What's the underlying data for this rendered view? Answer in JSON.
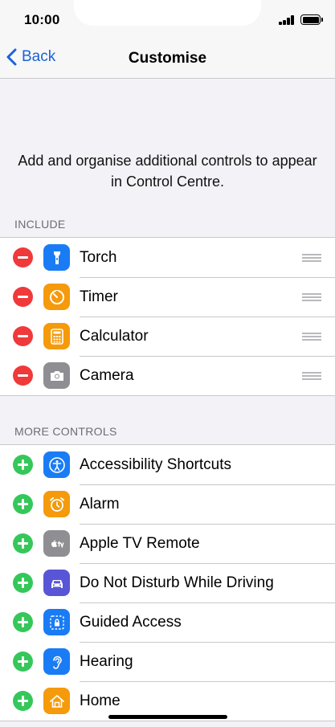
{
  "status_bar": {
    "time": "10:00"
  },
  "nav": {
    "back_label": "Back",
    "title": "Customise"
  },
  "intro": "Add and organise additional controls to appear in Control Centre.",
  "include": {
    "header": "INCLUDE",
    "items": [
      {
        "label": "Torch",
        "icon": "torch-icon",
        "color": "#1a7cf5"
      },
      {
        "label": "Timer",
        "icon": "timer-icon",
        "color": "#f59a0b"
      },
      {
        "label": "Calculator",
        "icon": "calculator-icon",
        "color": "#f59a0b"
      },
      {
        "label": "Camera",
        "icon": "camera-icon",
        "color": "#8e8e93"
      }
    ]
  },
  "more_controls": {
    "header": "MORE CONTROLS",
    "items": [
      {
        "label": "Accessibility Shortcuts",
        "icon": "accessibility-icon",
        "color": "#1a7cf5"
      },
      {
        "label": "Alarm",
        "icon": "alarm-icon",
        "color": "#f59a0b"
      },
      {
        "label": "Apple TV Remote",
        "icon": "apple-tv-icon",
        "color": "#8e8e93"
      },
      {
        "label": "Do Not Disturb While Driving",
        "icon": "car-icon",
        "color": "#5856d6"
      },
      {
        "label": "Guided Access",
        "icon": "lock-icon",
        "color": "#1a7cf5"
      },
      {
        "label": "Hearing",
        "icon": "ear-icon",
        "color": "#1a7cf5"
      },
      {
        "label": "Home",
        "icon": "home-icon",
        "color": "#f59a0b"
      }
    ]
  },
  "colors": {
    "accent": "#1a63d8",
    "remove": "#f0393a",
    "add": "#35c75a",
    "background": "#f2f2f7"
  }
}
